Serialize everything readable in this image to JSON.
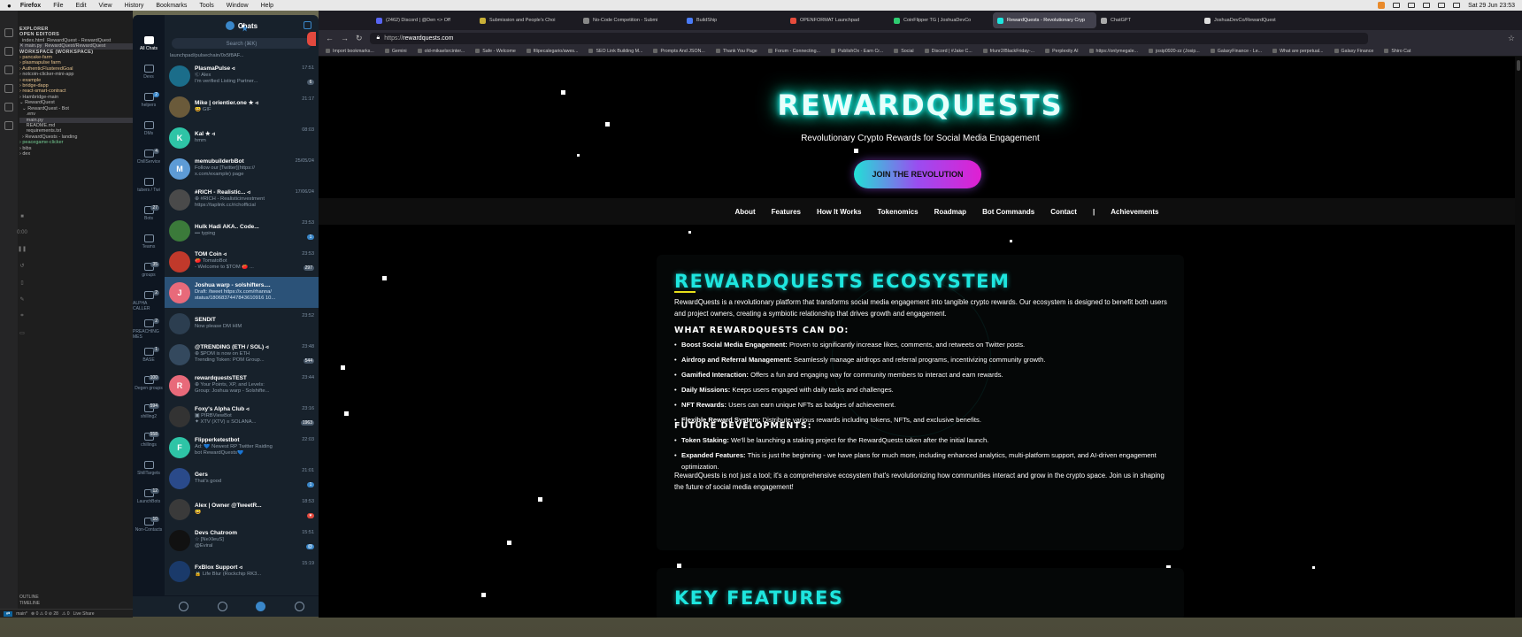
{
  "menubar": {
    "app": "Firefox",
    "items": [
      "File",
      "Edit",
      "View",
      "History",
      "Bookmarks",
      "Tools",
      "Window",
      "Help"
    ],
    "clock": "Sat 29 Jun  23:53"
  },
  "vscode": {
    "tree": [
      {
        "t": "EXPLORER",
        "c": "h"
      },
      {
        "t": "OPEN EDITORS",
        "c": "h"
      },
      {
        "t": "  index.html  RewardQuest - RewardQuest",
        "c": ""
      },
      {
        "t": "✕ main.py  RewardQuest/RewardQuest",
        "c": "sel"
      },
      {
        "t": "WORKSPACE (WORKSPACE)",
        "c": "h"
      },
      {
        "t": "› pancake-farm",
        "c": "y"
      },
      {
        "t": "› plasmapulse farm",
        "c": "y"
      },
      {
        "t": "› AuthenticFlusteredGoal",
        "c": "y"
      },
      {
        "t": "› notcoin-clicker-mini-app",
        "c": ""
      },
      {
        "t": "› example",
        "c": "y"
      },
      {
        "t": "› bridge-dapp",
        "c": "y"
      },
      {
        "t": "› react-smart-contract",
        "c": "y"
      },
      {
        "t": "› Hambridge-main",
        "c": ""
      },
      {
        "t": "⌄ RewardQuest",
        "c": ""
      },
      {
        "t": "  ⌄ RewardQuest - Bot",
        "c": ""
      },
      {
        "t": "     .env",
        "c": ""
      },
      {
        "t": "     main.py",
        "c": "sel"
      },
      {
        "t": "     README.md",
        "c": ""
      },
      {
        "t": "     requirements.txt",
        "c": ""
      },
      {
        "t": "  › RewardQuests - landing",
        "c": ""
      },
      {
        "t": "› peacegame-clicker",
        "c": "g"
      },
      {
        "t": "› bibs",
        "c": ""
      },
      {
        "t": "› dex",
        "c": ""
      }
    ],
    "outline": "OUTLINE",
    "timeline": "TIMELINE",
    "timer": "0:00",
    "status": {
      "branch": "main*",
      "errors": "⊗ 0 ⚠ 0 ⊘ 28",
      "warnings": "⚠ 0",
      "live": "Live Share"
    }
  },
  "telegram": {
    "title": "Chats",
    "search_placeholder": "Search (⌘K)",
    "folders": [
      {
        "label": "All Chats",
        "count": ""
      },
      {
        "label": "Devs",
        "count": ""
      },
      {
        "label": "helpers",
        "count": "2"
      },
      {
        "label": "DMs",
        "count": ""
      },
      {
        "label": "ChillService",
        "count": "4"
      },
      {
        "label": "tubers / Twi",
        "count": ""
      },
      {
        "label": "Bots",
        "count": "27"
      },
      {
        "label": "Teams",
        "count": ""
      },
      {
        "label": "groups",
        "count": "35"
      },
      {
        "label": "ALPHA CALLER",
        "count": "2"
      },
      {
        "label": "PREACHING MES",
        "count": "2"
      },
      {
        "label": "BASE",
        "count": "1"
      },
      {
        "label": "Degen groups",
        "count": "100"
      },
      {
        "label": "shilling2",
        "count": "594"
      },
      {
        "label": "chillings",
        "count": "558"
      },
      {
        "label": "ShillTargets",
        "count": ""
      },
      {
        "label": "LaunchBots",
        "count": "12"
      },
      {
        "label": "Non-Contacts",
        "count": "10"
      }
    ],
    "top_fragment": "launchpad/pulsechain/0x5f8AF...",
    "chats": [
      {
        "name": "PlasmaPulse ◃",
        "line1": "Ⓒ Alex",
        "line2": "I'm verified Listing Partner...",
        "time": "17:51",
        "badge": "6",
        "badge_style": "",
        "avatar": "#1b6d8a",
        "initial": "",
        "sel": false
      },
      {
        "name": "Mike | orientier.one ★ ◃",
        "line1": "😀 GIF",
        "line2": "",
        "time": "21:17",
        "badge": "",
        "badge_style": "",
        "avatar": "#6a5a3a",
        "initial": "",
        "sel": false
      },
      {
        "name": "Kal ★ ◃",
        "line1": "hmm",
        "line2": "",
        "time": "08:03",
        "badge": "",
        "badge_style": "",
        "avatar": "#2ec4a6",
        "initial": "K",
        "sel": false
      },
      {
        "name": "memubuilderbBot",
        "line1": "Follow our [Twitter](https://",
        "line2": "x.com/example) page",
        "time": "25/05/24",
        "badge": "",
        "badge_style": "",
        "avatar": "#5d9bd6",
        "initial": "M",
        "sel": false
      },
      {
        "name": "#RICH - Realistic... ◃",
        "line1": "⊕ #RICH - Realisticinvestment",
        "line2": "https://taplink.cc/richofficial",
        "time": "17/06/24",
        "badge": "",
        "badge_style": "",
        "avatar": "#4a4a4a",
        "initial": "",
        "sel": false
      },
      {
        "name": "Hulk Hadi AKA.. Code...",
        "line1": "••• typing",
        "line2": "",
        "time": "23:53",
        "badge": "1",
        "badge_style": "blue",
        "avatar": "#3b7a3a",
        "initial": "",
        "sel": false
      },
      {
        "name": "TOM Coin ◃",
        "line1": "🍅 TomatoBot",
        "line2": "- Welcome to $TOM 🍅 ...",
        "time": "23:53",
        "badge": "297",
        "badge_style": "",
        "avatar": "#c0392b",
        "initial": "",
        "sel": false
      },
      {
        "name": "Joshua warp - solshifters....",
        "line1": "Draft: /tweet https://x.com/rhanna/",
        "line2": "status/1806837447843610916 10...",
        "time": "",
        "badge": "",
        "badge_style": "",
        "avatar": "#e86a7a",
        "initial": "J",
        "sel": true
      },
      {
        "name": "SENDIT",
        "line1": "Now please DM HIM",
        "line2": "",
        "time": "23:52",
        "badge": "",
        "badge_style": "",
        "avatar": "#2c3e50",
        "initial": "",
        "sel": false
      },
      {
        "name": "@TRENDING (ETH / SOL) ◃",
        "line1": "⊕ $POM is now on ETH",
        "line2": "Trending Token: POM Group...",
        "time": "23:48",
        "badge": "544",
        "badge_style": "",
        "avatar": "#34495e",
        "initial": "",
        "sel": false
      },
      {
        "name": "rewardquestsTEST",
        "line1": "⊕ Your Points, XP, and Levels:",
        "line2": "Group: Joshua warp - Solshifte...",
        "time": "23:44",
        "badge": "",
        "badge_style": "",
        "avatar": "#e86a7a",
        "initial": "R",
        "sel": false
      },
      {
        "name": "Foxy's Alpha Club ◃",
        "line1": "▣ PIRBViewBot",
        "line2": "✦ XTV (XTV) ≡ SOLANA...",
        "time": "23:16",
        "badge": "1963",
        "badge_style": "",
        "avatar": "#333",
        "initial": "",
        "sel": false
      },
      {
        "name": "Flipperketestbot",
        "line1": "Ad: 💙 Newest RP Twitter Raiding",
        "line2": "bot RewardQuests💙",
        "time": "22:03",
        "badge": "",
        "badge_style": "",
        "avatar": "#2ec4a6",
        "initial": "F",
        "sel": false
      },
      {
        "name": "Gers",
        "line1": "That's good",
        "line2": "",
        "time": "21:01",
        "badge": "1",
        "badge_style": "blue",
        "avatar": "#2a4a8a",
        "initial": "",
        "sel": false
      },
      {
        "name": "Alex | Owner @TweetR...",
        "line1": "😀",
        "line2": "",
        "time": "18:53",
        "badge": "♥",
        "badge_style": "red",
        "avatar": "#3a3a3a",
        "initial": "",
        "sel": false
      },
      {
        "name": "Devs Chatroom",
        "line1": "☆ [NeXleuS]",
        "line2": "@Eviral",
        "time": "15:51",
        "badge": "@",
        "badge_style": "blue",
        "avatar": "#111",
        "initial": "",
        "sel": false
      },
      {
        "name": "FxBlox Support ◃",
        "line1": "🔒 Life Blur (Rockchip RK3...",
        "line2": "",
        "time": "15:19",
        "badge": "",
        "badge_style": "",
        "avatar": "#1a3a6a",
        "initial": "",
        "sel": false
      }
    ]
  },
  "firefox": {
    "tabs": [
      {
        "label": "(2462) Discord | @Den <> Off",
        "color": "#5865f2",
        "active": false
      },
      {
        "label": "Submission and People's Choi",
        "color": "#c9b037",
        "active": false
      },
      {
        "label": "No-Code Competition - Submi",
        "color": "#888",
        "active": false
      },
      {
        "label": "BuildShip",
        "color": "#4a7bf7",
        "active": false
      },
      {
        "label": "OPENFORMAT Launchpad",
        "color": "#e74c3c",
        "active": false
      },
      {
        "label": "CoinFlipper TG | JoshuaDevCo",
        "color": "#2ecc71",
        "active": false
      },
      {
        "label": "RewardQuests - Revolutionary Cryp",
        "color": "#1ee6df",
        "active": true
      },
      {
        "label": "ChatGPT",
        "color": "#aaa",
        "active": false
      },
      {
        "label": "JoshuaDevCo/RewardQuest",
        "color": "#ddd",
        "active": false
      }
    ],
    "url_proto": "https://",
    "url_host": "rewardquests.com",
    "bookmarks": [
      "Import bookmarks...",
      "Gemini",
      "old-mikaelsrcinter...",
      "Safe - Welcome",
      "filipecalegario/awes...",
      "SEO Link Building M...",
      "Prompts And JSON...",
      "Thank You Page",
      "Forum - Connecting...",
      "PublishOx - Earn Cr...",
      "Social",
      "Discord | #Jake C...",
      "frlunr2/BlackFriday-...",
      "Perplexity AI",
      "https://onlymegale...",
      "josip0920-zz (Josip...",
      "GalaxyFinance - Le...",
      "What are perpetual...",
      "Galaxy Finance",
      "Shiro Cat"
    ]
  },
  "site": {
    "title": "REWARDQUESTS",
    "subtitle": "Revolutionary Crypto Rewards for Social Media Engagement",
    "cta": "JOIN THE REVOLUTION",
    "nav": [
      "About",
      "Features",
      "How It Works",
      "Tokenomics",
      "Roadmap",
      "Bot Commands",
      "Contact",
      "|",
      "Achievements"
    ],
    "ecosystem": {
      "title": "REWARDQUESTS ECOSYSTEM",
      "intro": "RewardQuests is a revolutionary platform that transforms social media engagement into tangible crypto rewards. Our ecosystem is designed to benefit both users and project owners, creating a symbiotic relationship that drives growth and engagement.",
      "can_do_title": "WHAT REWARDQUESTS CAN DO:",
      "can_do": [
        {
          "b": "Boost Social Media Engagement:",
          "t": " Proven to significantly increase likes, comments, and retweets on Twitter posts."
        },
        {
          "b": "Airdrop and Referral Management:",
          "t": " Seamlessly manage airdrops and referral programs, incentivizing community growth."
        },
        {
          "b": "Gamified Interaction:",
          "t": " Offers a fun and engaging way for community members to interact and earn rewards."
        },
        {
          "b": "Daily Missions:",
          "t": " Keeps users engaged with daily tasks and challenges."
        },
        {
          "b": "NFT Rewards:",
          "t": " Users can earn unique NFTs as badges of achievement."
        },
        {
          "b": "Flexible Reward System:",
          "t": " Distribute various rewards including tokens, NFTs, and exclusive benefits."
        }
      ],
      "future_title": "FUTURE DEVELOPMENTS:",
      "future": [
        {
          "b": "Token Staking:",
          "t": " We'll be launching a staking project for the RewardQuests token after the initial launch."
        },
        {
          "b": "Expanded Features:",
          "t": " This is just the beginning - we have plans for much more, including enhanced analytics, multi-platform support, and AI-driven engagement optimization."
        }
      ],
      "closing": "RewardQuests is not just a tool; it's a comprehensive ecosystem that's revolutionizing how communities interact and grow in the crypto space. Join us in shaping the future of social media engagement!"
    },
    "key_features_title": "KEY FEATURES"
  },
  "colors": {
    "accent": "#1ee6df",
    "telegram_bg": "#17212b",
    "telegram_sel": "#2b5278",
    "underline": "#e8e01a"
  }
}
